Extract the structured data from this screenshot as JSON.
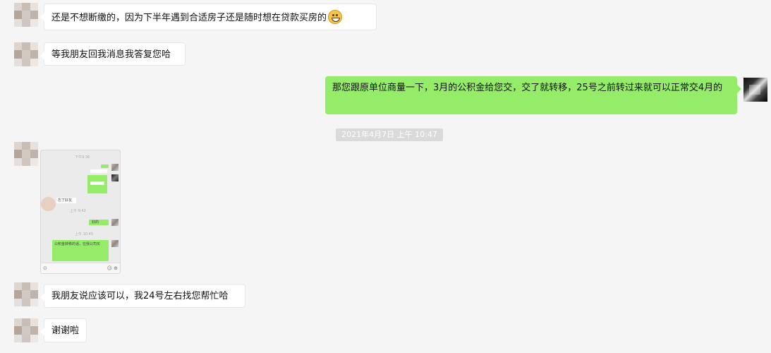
{
  "messages": {
    "m1": {
      "text": "还是不想断缴的，因为下半年遇到合适房子还是随时想在贷款买房的",
      "emoji": "grinning-face-icon"
    },
    "m2": {
      "text": "等我朋友回我消息我答复您哈"
    },
    "m3": {
      "text": "那您跟原单位商量一下，3月的公积金给您交，交了就转移，25号之前转过来就可以正常交4月的"
    },
    "timestamp": "2021年4月7日 上午 10:47",
    "m5": {
      "text": "我朋友说应该可以，我24号左右找您帮忙哈"
    },
    "m6": {
      "text": "谢谢啦"
    }
  },
  "screenshot_image": {
    "top_time": "下午9:36",
    "reply_label": "忘了好友",
    "time_2": "上午 9:42",
    "green_short": "好的",
    "time_3": "上午 10:45",
    "long_green": "公积金转移的话，在我公司买",
    "footer_left": "⊙",
    "footer_right": "☺ ⊕"
  },
  "colors": {
    "background": "#f5f5f5",
    "left_bubble": "#ffffff",
    "right_bubble": "#95ec69",
    "timestamp_bg": "#dadada"
  }
}
